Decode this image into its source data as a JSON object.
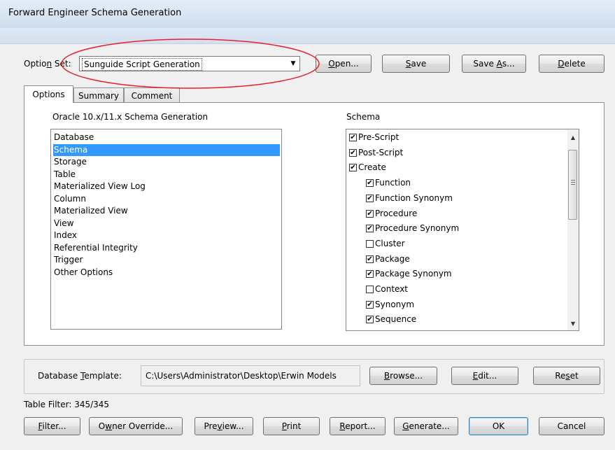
{
  "window": {
    "title": "Forward Engineer Schema Generation"
  },
  "option_set": {
    "label_pre": "Optio",
    "label_ul": "n",
    "label_post": " Set:",
    "selected": "Sunguide Script Generation",
    "buttons": {
      "open": {
        "ul": "O",
        "rest": "pen..."
      },
      "save": {
        "ul": "S",
        "rest": "ave"
      },
      "save_as": {
        "pre": "Save ",
        "ul": "A",
        "rest": "s..."
      },
      "delete": {
        "ul": "D",
        "rest": "elete"
      }
    }
  },
  "tabs": [
    "Options",
    "Summary",
    "Comment"
  ],
  "left_panel": {
    "heading": "Oracle 10.x/11.x Schema Generation",
    "items": [
      "Database",
      "Schema",
      "Storage",
      "Table",
      "Materialized View Log",
      "Column",
      "Materialized View",
      "View",
      "Index",
      "Referential Integrity",
      "Trigger",
      "Other Options"
    ],
    "selected_index": 1
  },
  "right_panel": {
    "heading": "Schema",
    "items": [
      {
        "label": "Pre-Script",
        "checked": true,
        "indent": 0
      },
      {
        "label": "Post-Script",
        "checked": true,
        "indent": 0
      },
      {
        "label": "Create",
        "checked": true,
        "indent": 0
      },
      {
        "label": "Function",
        "checked": true,
        "indent": 1
      },
      {
        "label": "Function Synonym",
        "checked": true,
        "indent": 1
      },
      {
        "label": "Procedure",
        "checked": true,
        "indent": 1
      },
      {
        "label": "Procedure Synonym",
        "checked": true,
        "indent": 1
      },
      {
        "label": "Cluster",
        "checked": false,
        "indent": 1
      },
      {
        "label": "Package",
        "checked": true,
        "indent": 1
      },
      {
        "label": "Package Synonym",
        "checked": true,
        "indent": 1
      },
      {
        "label": "Context",
        "checked": false,
        "indent": 1
      },
      {
        "label": "Synonym",
        "checked": true,
        "indent": 1
      },
      {
        "label": "Sequence",
        "checked": true,
        "indent": 1
      }
    ]
  },
  "template": {
    "label_pre": "Database ",
    "label_ul": "T",
    "label_post": "emplate:",
    "value": "C:\\Users\\Administrator\\Desktop\\Erwin Models",
    "buttons": {
      "browse": {
        "ul": "B",
        "rest": "rowse..."
      },
      "edit": {
        "ul": "E",
        "rest": "dit..."
      },
      "reset": {
        "pre": "Re",
        "ul": "s",
        "rest": "et"
      }
    }
  },
  "table_filter": "Table Filter: 345/345",
  "bottom_buttons": {
    "filter": {
      "pre": "",
      "ul": "F",
      "rest": "ilter..."
    },
    "owner_override": {
      "pre": "O",
      "ul": "w",
      "rest": "ner Override..."
    },
    "preview": {
      "pre": "Pre",
      "ul": "v",
      "rest": "iew..."
    },
    "print": {
      "pre": "",
      "ul": "P",
      "rest": "rint"
    },
    "report": {
      "pre": "",
      "ul": "R",
      "rest": "eport..."
    },
    "generate": {
      "pre": "",
      "ul": "G",
      "rest": "enerate..."
    },
    "ok": "OK",
    "cancel": "Cancel"
  },
  "colors": {
    "selection": "#3399ff",
    "annotation": "#e8202a"
  },
  "icons": {
    "dropdown": "chevron-down-icon",
    "checkbox": "checkmark-icon"
  }
}
